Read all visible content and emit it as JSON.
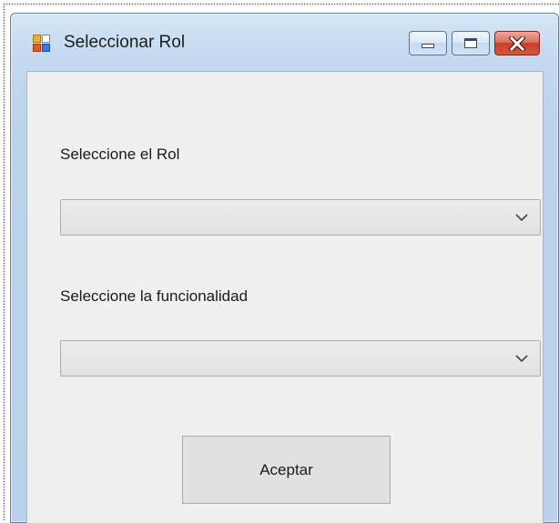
{
  "window": {
    "title": "Seleccionar Rol",
    "icon": "app-form-icon"
  },
  "caption_buttons": {
    "minimize_icon": "minimize-icon",
    "maximize_icon": "maximize-icon",
    "close_icon": "close-icon",
    "close_color": "#c9402a"
  },
  "form": {
    "rol_label": "Seleccione el Rol",
    "rol_selected": "",
    "funcionalidad_label": "Seleccione la funcionalidad",
    "funcionalidad_selected": "",
    "accept_label": "Aceptar"
  },
  "colors": {
    "frame_accent": "#b9d1ea",
    "client_background": "#f0f0f0",
    "button_face": "#e1e1e1"
  }
}
